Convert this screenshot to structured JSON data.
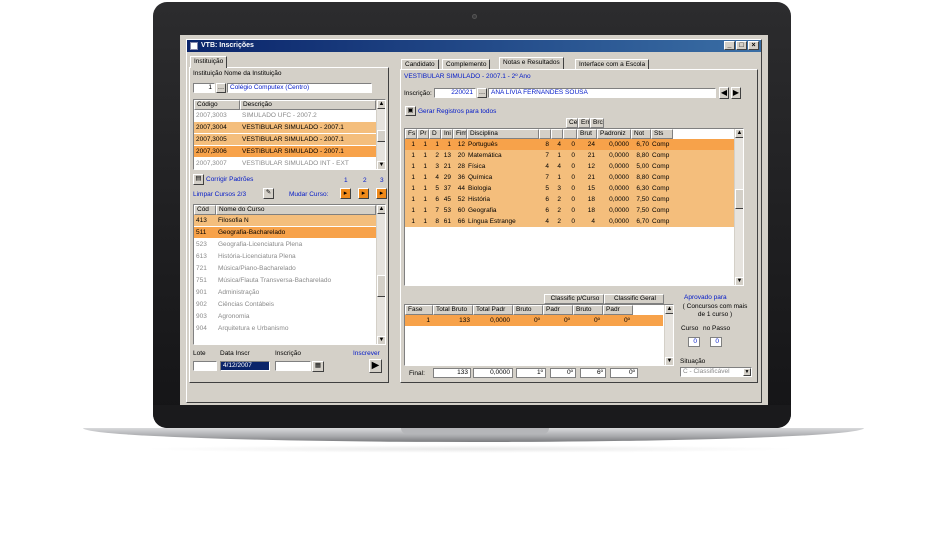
{
  "window": {
    "title": "VTB: Inscrições",
    "min": "_",
    "max": "□",
    "close": "×"
  },
  "left": {
    "tab": "Instituição",
    "inst_label": "Instituição Nome da Instituição",
    "inst_code": "1",
    "inst_name": "Colégio Computex (Centro)",
    "sim_headers": [
      "Código",
      "Descrição"
    ],
    "simulados": [
      {
        "code": "2007,3003",
        "desc": "SIMULADO UFC - 2007.2"
      },
      {
        "code": "2007,3004",
        "desc": "VESTIBULAR SIMULADO - 2007.1"
      },
      {
        "code": "2007,3005",
        "desc": "VESTIBULAR SIMULADO - 2007.1"
      },
      {
        "code": "2007,3006",
        "desc": "VESTIBULAR SIMULADO - 2007.1"
      },
      {
        "code": "2007,3007",
        "desc": "VESTIBULAR SIMULADO INT - EXT"
      }
    ],
    "corrigir": "Corrigir Padrões",
    "limpar": "Limpar Cursos 2/3",
    "mudar": "Mudar Curso:",
    "nums": [
      "1",
      "2",
      "3"
    ],
    "curso_headers": [
      "Cód",
      "Nome do Curso"
    ],
    "cursos": [
      {
        "code": "413",
        "name": "Filosofia N"
      },
      {
        "code": "511",
        "name": "Geografia-Bacharelado"
      },
      {
        "code": "523",
        "name": "Geografia-Licenciatura Plena"
      },
      {
        "code": "613",
        "name": "História-Licenciatura Plena"
      },
      {
        "code": "721",
        "name": "Música/Piano-Bacharelado"
      },
      {
        "code": "751",
        "name": "Música/Flauta Transversa-Bacharelado"
      },
      {
        "code": "901",
        "name": "Administração"
      },
      {
        "code": "902",
        "name": "Ciências Contábeis"
      },
      {
        "code": "903",
        "name": "Agronomia"
      },
      {
        "code": "904",
        "name": "Arquitetura e Urbanismo"
      }
    ],
    "lote_label": "Lote",
    "data_label": "Data Inscr",
    "insc_label": "Inscrição",
    "inscrever": "Inscrever",
    "data_value": "4/12/2007"
  },
  "right": {
    "tabs": [
      "Candidato",
      "Complemento",
      "Notas e Resultados",
      "Interface com a Escola"
    ],
    "heading": "VESTIBULAR SIMULADO - 2007.1 - 2º Ano",
    "insc_label": "Inscrição:",
    "insc_value": "220021",
    "cand_name": "ANA LIVIA FERNANDES SOUSA",
    "gerar": "Gerar Registros para todos",
    "group_headers": [
      "Cer",
      "Err",
      "Brc"
    ],
    "notas_headers": [
      "Fs",
      "Pr",
      "D",
      "Ini",
      "Fim",
      "Disciplina",
      "",
      "",
      "",
      "Brut",
      "Padroniz",
      "Not",
      "Sts"
    ],
    "notas": [
      [
        "1",
        "1",
        "1",
        "1",
        "12",
        "Português",
        "8",
        "4",
        "0",
        "24",
        "0,0000",
        "6,70",
        "Comp"
      ],
      [
        "1",
        "1",
        "2",
        "13",
        "20",
        "Matemática",
        "7",
        "1",
        "0",
        "21",
        "0,0000",
        "8,80",
        "Comp"
      ],
      [
        "1",
        "1",
        "3",
        "21",
        "28",
        "Física",
        "4",
        "4",
        "0",
        "12",
        "0,0000",
        "5,00",
        "Comp"
      ],
      [
        "1",
        "1",
        "4",
        "29",
        "36",
        "Química",
        "7",
        "1",
        "0",
        "21",
        "0,0000",
        "8,80",
        "Comp"
      ],
      [
        "1",
        "1",
        "5",
        "37",
        "44",
        "Biologia",
        "5",
        "3",
        "0",
        "15",
        "0,0000",
        "6,30",
        "Comp"
      ],
      [
        "1",
        "1",
        "6",
        "45",
        "52",
        "História",
        "6",
        "2",
        "0",
        "18",
        "0,0000",
        "7,50",
        "Comp"
      ],
      [
        "1",
        "1",
        "7",
        "53",
        "60",
        "Geografia",
        "6",
        "2",
        "0",
        "18",
        "0,0000",
        "7,50",
        "Comp"
      ],
      [
        "1",
        "1",
        "8",
        "61",
        "66",
        "Língua Estrange",
        "4",
        "2",
        "0",
        "4",
        "0,0000",
        "6,70",
        "Comp"
      ]
    ],
    "class_curso": "Classific p/Curso",
    "class_geral": "Classific Geral",
    "res_headers": [
      "Fase",
      "Total Bruto",
      "Total Padr",
      "Bruto",
      "Padr",
      "Bruto",
      "Padr"
    ],
    "res_row": [
      "1",
      "133",
      "0,0000",
      "0º",
      "0º",
      "0º",
      "0º"
    ],
    "final_label": "Final:",
    "final_row": [
      "133",
      "0,0000",
      "1º",
      "0º",
      "6º",
      "0º"
    ],
    "aprovado": "Aprovado para",
    "concursos": "( Concursos com mais de 1 curso )",
    "curso_label": "Curso",
    "nopasso_label": "no Passo",
    "curso_val": "0",
    "nopasso_val": "0",
    "situacao_label": "Situação",
    "situacao_value": "C - Classificável"
  }
}
